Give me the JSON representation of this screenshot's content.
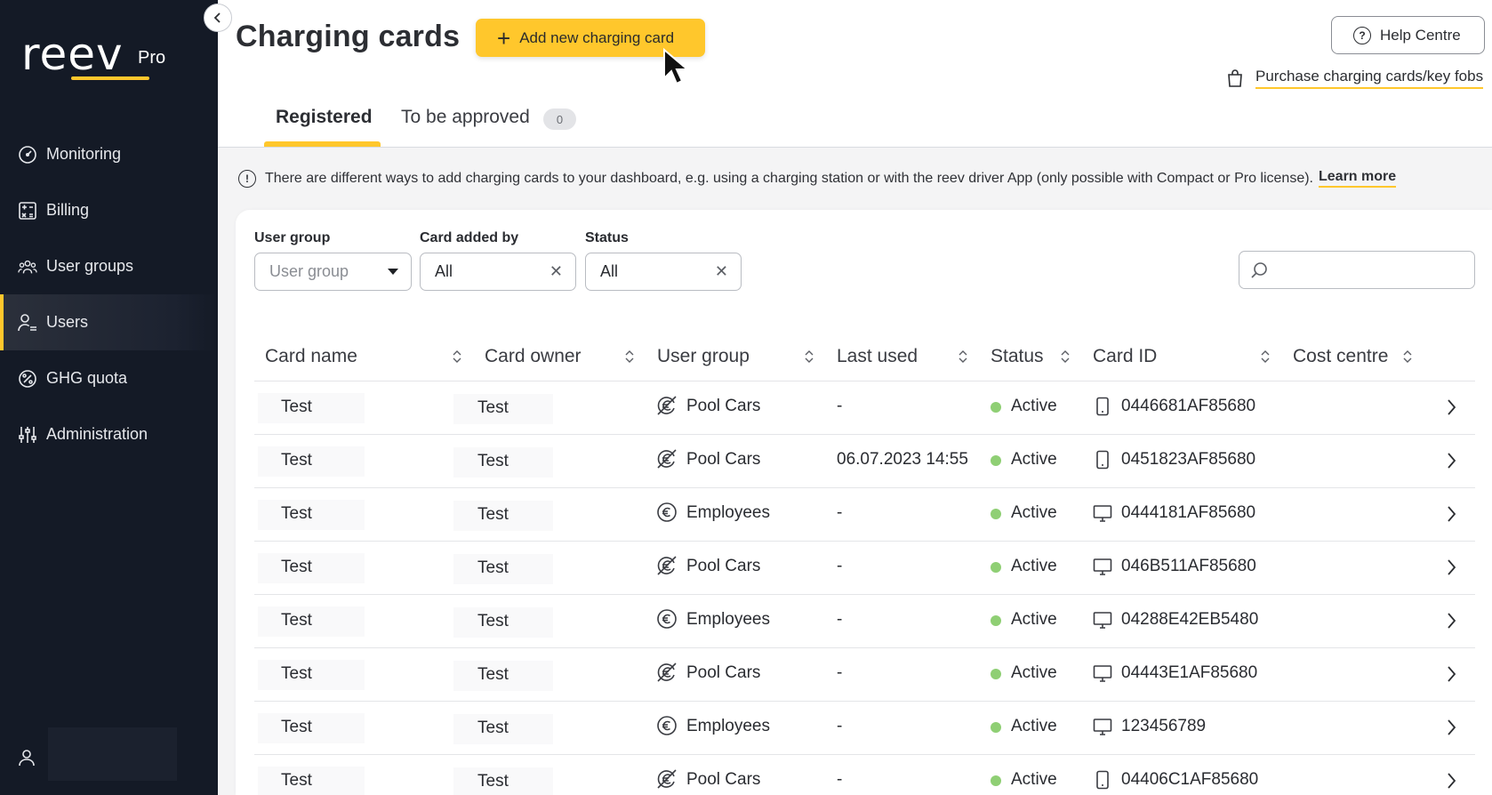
{
  "brand": {
    "name": "reev",
    "tier": "Pro",
    "accent": "#ffc72c",
    "sidebar_bg": "#141a26",
    "status_active_color": "#8fcf74"
  },
  "sidebar": {
    "items": [
      {
        "label": "Monitoring",
        "icon": "gauge-icon",
        "active": false
      },
      {
        "label": "Billing",
        "icon": "calculator-icon",
        "active": false
      },
      {
        "label": "User groups",
        "icon": "user-group-icon",
        "active": false
      },
      {
        "label": "Users",
        "icon": "users-icon",
        "active": true
      },
      {
        "label": "GHG quota",
        "icon": "percent-leaf-icon",
        "active": false
      },
      {
        "label": "Administration",
        "icon": "sliders-icon",
        "active": false
      }
    ]
  },
  "header": {
    "title": "Charging cards",
    "add_button": "Add new charging card",
    "help_button": "Help Centre",
    "purchase_link": "Purchase charging cards/key fobs"
  },
  "tabs": [
    {
      "label": "Registered",
      "active": true
    },
    {
      "label": "To be approved",
      "badge": "0",
      "active": false
    }
  ],
  "info": {
    "text": "There are different ways to add charging cards to your dashboard, e.g. using a charging station or with the reev driver App (only possible with Compact or Pro license).",
    "link": "Learn more"
  },
  "filters": {
    "user_group": {
      "label": "User group",
      "placeholder": "User group"
    },
    "card_added_by": {
      "label": "Card added by",
      "value": "All"
    },
    "status": {
      "label": "Status",
      "value": "All"
    },
    "search": {
      "placeholder": ""
    }
  },
  "table": {
    "columns": [
      "Card name",
      "Card owner",
      "User group",
      "Last used",
      "Status",
      "Card ID",
      "Cost centre"
    ],
    "rows": [
      {
        "name": "Test",
        "owner": "Test",
        "group": "Pool Cars",
        "group_icon": "no-cost-icon",
        "last_used": "-",
        "status": "Active",
        "device": "phone-icon",
        "card_id": "0446681AF85680",
        "cost_centre": ""
      },
      {
        "name": "Test",
        "owner": "Test",
        "group": "Pool Cars",
        "group_icon": "no-cost-icon",
        "last_used": "06.07.2023 14:55",
        "status": "Active",
        "device": "phone-icon",
        "card_id": "0451823AF85680",
        "cost_centre": ""
      },
      {
        "name": "Test",
        "owner": "Test",
        "group": "Employees",
        "group_icon": "euro-icon",
        "last_used": "-",
        "status": "Active",
        "device": "monitor-icon",
        "card_id": "0444181AF85680",
        "cost_centre": ""
      },
      {
        "name": "Test",
        "owner": "Test",
        "group": "Pool Cars",
        "group_icon": "no-cost-icon",
        "last_used": "-",
        "status": "Active",
        "device": "monitor-icon",
        "card_id": "046B511AF85680",
        "cost_centre": ""
      },
      {
        "name": "Test",
        "owner": "Test",
        "group": "Employees",
        "group_icon": "euro-icon",
        "last_used": "-",
        "status": "Active",
        "device": "monitor-icon",
        "card_id": "04288E42EB5480",
        "cost_centre": ""
      },
      {
        "name": "Test",
        "owner": "Test",
        "group": "Pool Cars",
        "group_icon": "no-cost-icon",
        "last_used": "-",
        "status": "Active",
        "device": "monitor-icon",
        "card_id": "04443E1AF85680",
        "cost_centre": ""
      },
      {
        "name": "Test",
        "owner": "Test",
        "group": "Employees",
        "group_icon": "euro-icon",
        "last_used": "-",
        "status": "Active",
        "device": "monitor-icon",
        "card_id": "123456789",
        "cost_centre": ""
      },
      {
        "name": "Test",
        "owner": "Test",
        "group": "Pool Cars",
        "group_icon": "no-cost-icon",
        "last_used": "-",
        "status": "Active",
        "device": "phone-icon",
        "card_id": "04406C1AF85680",
        "cost_centre": ""
      }
    ]
  }
}
